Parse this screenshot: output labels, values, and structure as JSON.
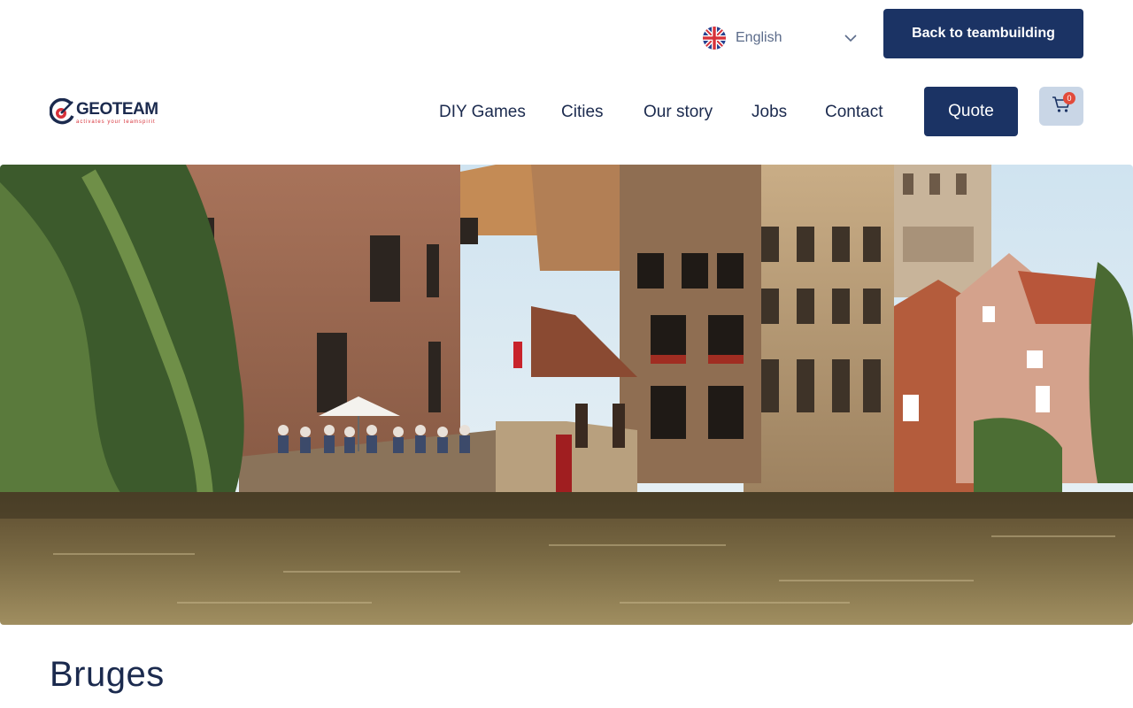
{
  "topbar": {
    "language": {
      "label": "English",
      "icon": "uk-flag-icon"
    },
    "back_button": "Back to teambuilding"
  },
  "header": {
    "logo": {
      "name": "GEOTEAM",
      "tagline": "activates your teamspirit"
    },
    "nav": [
      {
        "label": "DIY Games"
      },
      {
        "label": "Cities"
      },
      {
        "label": "Our story"
      },
      {
        "label": "Jobs"
      },
      {
        "label": "Contact"
      }
    ],
    "quote_button": "Quote",
    "cart": {
      "count": "0",
      "icon": "shopping-cart-icon"
    }
  },
  "hero": {
    "image": "canal-city-photo"
  },
  "page": {
    "title": "Bruges"
  },
  "colors": {
    "primary": "#1b3364",
    "text": "#1b2a4e",
    "accent": "#e24b3b",
    "cart_bg": "#c9d6e6"
  }
}
